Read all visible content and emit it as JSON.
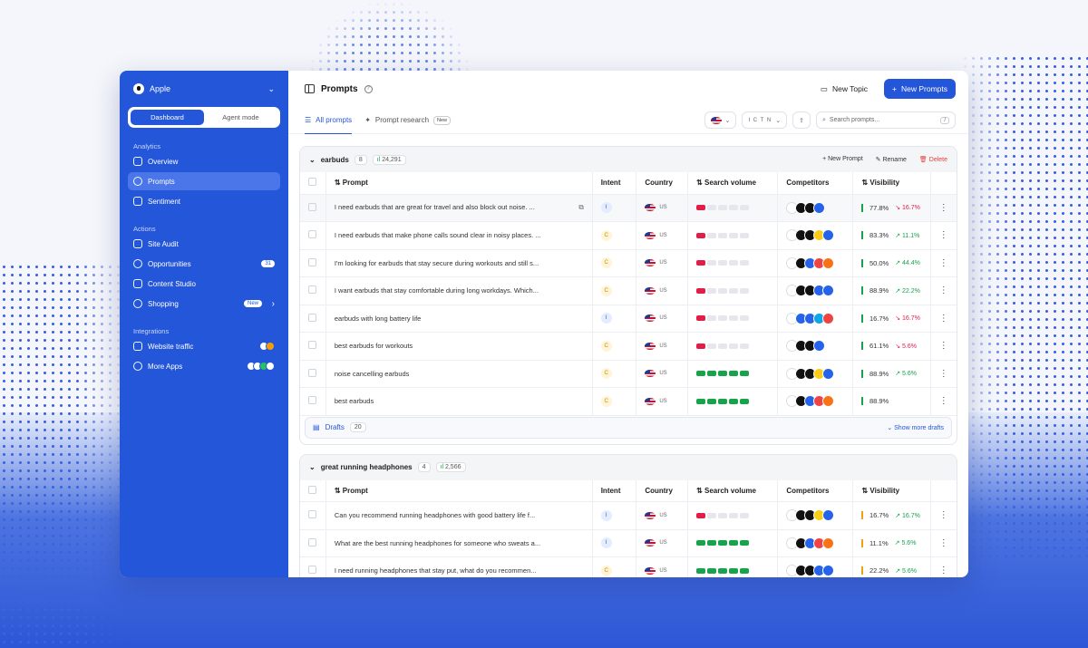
{
  "sidebar": {
    "org": "Apple",
    "mode_tabs": [
      "Dashboard",
      "Agent mode"
    ],
    "analytics_label": "Analytics",
    "analytics": [
      {
        "label": "Overview",
        "icon": "chart-icon"
      },
      {
        "label": "Prompts",
        "icon": "chat-bubble-icon",
        "selected": true
      },
      {
        "label": "Sentiment",
        "icon": "pie-icon"
      }
    ],
    "actions_label": "Actions",
    "actions": [
      {
        "label": "Site Audit",
        "icon": "gauge-icon"
      },
      {
        "label": "Opportunities",
        "icon": "bolt-icon",
        "badge": "31"
      },
      {
        "label": "Content Studio",
        "icon": "document-icon"
      },
      {
        "label": "Shopping",
        "icon": "bag-icon",
        "badge": "New"
      }
    ],
    "integrations_label": "Integrations",
    "integrations": [
      {
        "label": "Website traffic",
        "icon": "globe-icon"
      },
      {
        "label": "More Apps",
        "icon": "grid-icon"
      }
    ]
  },
  "header": {
    "title": "Prompts",
    "new_topic": "New Topic",
    "new_prompts": "New Prompts"
  },
  "tabs": {
    "all": "All prompts",
    "research": "Prompt research",
    "research_badge": "New"
  },
  "filters": {
    "llms": "I C T N",
    "search_placeholder": "Search prompts...",
    "search_kbd": "/"
  },
  "columns": {
    "prompt": "Prompt",
    "intent": "Intent",
    "country": "Country",
    "volume": "Search volume",
    "competitors": "Competitors",
    "visibility": "Visibility"
  },
  "groups": [
    {
      "name": "earbuds",
      "count": "8",
      "volume": "24,291",
      "actions": {
        "new_prompt": "New Prompt",
        "rename": "Rename",
        "delete": "Delete"
      },
      "rows": [
        {
          "prompt": "I need earbuds that are great for travel and also block out noise. ...",
          "intent": "I",
          "country": "US",
          "vol": "lo",
          "vis": "77.8%",
          "delta": "16.7%",
          "dir": "down"
        },
        {
          "prompt": "I need earbuds that make phone calls sound clear in noisy places. ...",
          "intent": "C",
          "country": "US",
          "vol": "lo",
          "vis": "83.3%",
          "delta": "11.1%",
          "dir": "up"
        },
        {
          "prompt": "I'm looking for earbuds that stay secure during workouts and still s...",
          "intent": "C",
          "country": "US",
          "vol": "lo",
          "vis": "50.0%",
          "delta": "44.4%",
          "dir": "up"
        },
        {
          "prompt": "I want earbuds that stay comfortable during long workdays. Which...",
          "intent": "C",
          "country": "US",
          "vol": "lo",
          "vis": "88.9%",
          "delta": "22.2%",
          "dir": "up"
        },
        {
          "prompt": "earbuds with long battery life",
          "intent": "I",
          "country": "US",
          "vol": "lo",
          "vis": "16.7%",
          "delta": "16.7%",
          "dir": "down"
        },
        {
          "prompt": "best earbuds for workouts",
          "intent": "C",
          "country": "US",
          "vol": "lo",
          "vis": "61.1%",
          "delta": "5.6%",
          "dir": "down"
        },
        {
          "prompt": "noise cancelling earbuds",
          "intent": "C",
          "country": "US",
          "vol": "hi",
          "vis": "88.9%",
          "delta": "5.6%",
          "dir": "up"
        },
        {
          "prompt": "best earbuds",
          "intent": "C",
          "country": "US",
          "vol": "hi",
          "vis": "88.9%",
          "delta": "",
          "dir": ""
        }
      ],
      "drafts": "Drafts",
      "drafts_count": "20",
      "show_more": "Show more drafts"
    },
    {
      "name": "great running headphones",
      "count": "4",
      "volume": "2,566",
      "rows": [
        {
          "prompt": "Can you recommend running headphones with good battery life f...",
          "intent": "I",
          "country": "US",
          "vol": "lo",
          "vis": "16.7%",
          "delta": "16.7%",
          "dir": "up"
        },
        {
          "prompt": "What are the best running headphones for someone who sweats a...",
          "intent": "I",
          "country": "US",
          "vol": "hi",
          "vis": "11.1%",
          "delta": "5.6%",
          "dir": "up"
        },
        {
          "prompt": "I need running headphones that stay put, what do you recommen...",
          "intent": "C",
          "country": "US",
          "vol": "hi",
          "vis": "22.2%",
          "delta": "5.6%",
          "dir": "up"
        }
      ]
    }
  ],
  "colors": {
    "brand": "#2456d9",
    "up": "#16a34a",
    "down": "#e11d48"
  }
}
